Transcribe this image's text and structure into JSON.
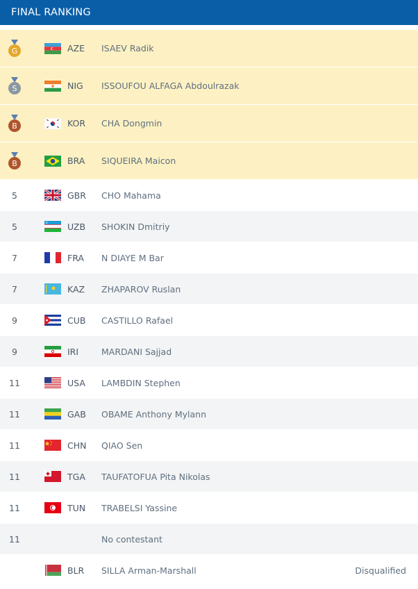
{
  "header": {
    "title": "FINAL RANKING"
  },
  "colors": {
    "header_bg": "#0a5ea8",
    "medal_row_bg": "#fdf1c3",
    "row_alt_bg": "#f3f4f5",
    "gold": "#e4a72a",
    "silver": "#8b97a1",
    "bronze": "#b0552c"
  },
  "rows": [
    {
      "rank": "G",
      "medal": "gold",
      "code": "AZE",
      "name": "ISAEV Radik",
      "flag": "aze-flag-icon",
      "note": ""
    },
    {
      "rank": "S",
      "medal": "silver",
      "code": "NIG",
      "name": "ISSOUFOU ALFAGA Abdoulrazak",
      "flag": "nig-flag-icon",
      "note": ""
    },
    {
      "rank": "B",
      "medal": "bronze",
      "code": "KOR",
      "name": "CHA Dongmin",
      "flag": "kor-flag-icon",
      "note": ""
    },
    {
      "rank": "B",
      "medal": "bronze",
      "code": "BRA",
      "name": "SIQUEIRA Maicon",
      "flag": "bra-flag-icon",
      "note": ""
    },
    {
      "rank": "5",
      "code": "GBR",
      "name": "CHO Mahama",
      "flag": "gbr-flag-icon",
      "note": ""
    },
    {
      "rank": "5",
      "code": "UZB",
      "name": "SHOKIN Dmitriy",
      "flag": "uzb-flag-icon",
      "note": ""
    },
    {
      "rank": "7",
      "code": "FRA",
      "name": "N DIAYE M Bar",
      "flag": "fra-flag-icon",
      "note": ""
    },
    {
      "rank": "7",
      "code": "KAZ",
      "name": "ZHAPAROV Ruslan",
      "flag": "kaz-flag-icon",
      "note": ""
    },
    {
      "rank": "9",
      "code": "CUB",
      "name": "CASTILLO Rafael",
      "flag": "cub-flag-icon",
      "note": ""
    },
    {
      "rank": "9",
      "code": "IRI",
      "name": "MARDANI Sajjad",
      "flag": "iri-flag-icon",
      "note": ""
    },
    {
      "rank": "11",
      "code": "USA",
      "name": "LAMBDIN Stephen",
      "flag": "usa-flag-icon",
      "note": ""
    },
    {
      "rank": "11",
      "code": "GAB",
      "name": "OBAME Anthony Mylann",
      "flag": "gab-flag-icon",
      "note": ""
    },
    {
      "rank": "11",
      "code": "CHN",
      "name": "QIAO Sen",
      "flag": "chn-flag-icon",
      "note": ""
    },
    {
      "rank": "11",
      "code": "TGA",
      "name": "TAUFATOFUA Pita Nikolas",
      "flag": "tga-flag-icon",
      "note": ""
    },
    {
      "rank": "11",
      "code": "TUN",
      "name": "TRABELSI Yassine",
      "flag": "tun-flag-icon",
      "note": ""
    },
    {
      "rank": "11",
      "code": "",
      "name": "No contestant",
      "flag": "",
      "note": ""
    },
    {
      "rank": "",
      "code": "BLR",
      "name": "SILLA Arman-Marshall",
      "flag": "blr-flag-icon",
      "note": "Disqualified"
    }
  ]
}
